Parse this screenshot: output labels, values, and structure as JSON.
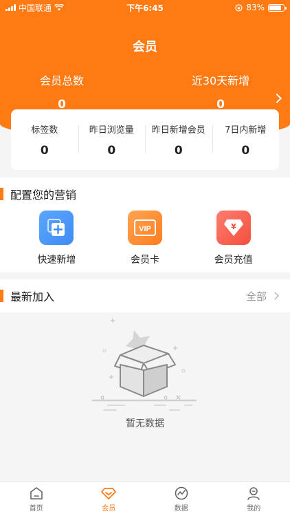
{
  "status_bar": {
    "carrier": "中国联通",
    "time": "下午6:45",
    "battery": "83%",
    "battery_level": 0.83
  },
  "header": {
    "title": "会员",
    "total_members_label": "会员总数",
    "total_members_value": "0",
    "new_30d_label": "近30天新增",
    "new_30d_value": "0"
  },
  "stats": [
    {
      "label": "标签数",
      "value": "0"
    },
    {
      "label": "昨日浏览量",
      "value": "0"
    },
    {
      "label": "昨日新增会员",
      "value": "0"
    },
    {
      "label": "7日内新增",
      "value": "0"
    }
  ],
  "marketing": {
    "title": "配置您的营销",
    "tools": [
      {
        "label": "快速新增",
        "icon": "add-member-icon"
      },
      {
        "label": "会员卡",
        "icon": "vip-card-icon"
      },
      {
        "label": "会员充值",
        "icon": "recharge-icon"
      }
    ]
  },
  "latest": {
    "title": "最新加入",
    "see_all": "全部",
    "empty_text": "暂无数据"
  },
  "tabbar": [
    {
      "label": "首页",
      "icon": "home-icon"
    },
    {
      "label": "会员",
      "icon": "member-diamond-icon"
    },
    {
      "label": "数据",
      "icon": "chart-icon"
    },
    {
      "label": "我的",
      "icon": "profile-icon"
    }
  ],
  "colors": {
    "accent": "#ff7a12",
    "blue_icon": "#3f8cf4",
    "orange_icon": "#ff8a2a",
    "red_icon": "#f55a4e"
  }
}
